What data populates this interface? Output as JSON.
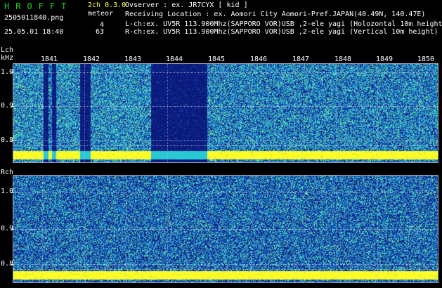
{
  "header": {
    "app_title": "HROFFT",
    "version": "2ch 0.3.0",
    "file_name": "2505011840.png",
    "datetime": "25.05.01 18:40",
    "meteor_label": "meteor",
    "lch_count": "4",
    "rch_count": "63",
    "observer": "Ovserver                  : ex. JR7CYX [ kid ]",
    "location": "Receiving Location : ex. Aomori City Aomori-Pref.JAPAN(40.49N, 140.47E)",
    "lch_info": "L-ch:ex. UV5R 113.900Mhz(SAPPORO VOR)USB ,2-ele yagi (Holozontal 10m height",
    "rch_info": "R-ch:ex. UV5R 113.900Mhz(SAPPORO VOR)USB ,2-ele yagi (Vertical 10m height)"
  },
  "lch": {
    "label": "Lch",
    "unit": "kHz",
    "ticks": [
      "1.0",
      "0.9",
      "0.8"
    ]
  },
  "rch": {
    "label": "Rch",
    "ticks": [
      "1.0",
      "0.9",
      "0.8"
    ]
  },
  "time_labels": [
    "1841",
    "1842",
    "1843",
    "1844",
    "1845",
    "1846",
    "1847",
    "1848",
    "1849",
    "1850"
  ],
  "colors": {
    "background": "#000000",
    "noise_dark": "#0a1a7a",
    "noise_mid": "#1e5fd0",
    "noise_cyan": "#2ad0c8",
    "signal_yellow": "#ffff33",
    "title_green": "#21d421"
  }
}
